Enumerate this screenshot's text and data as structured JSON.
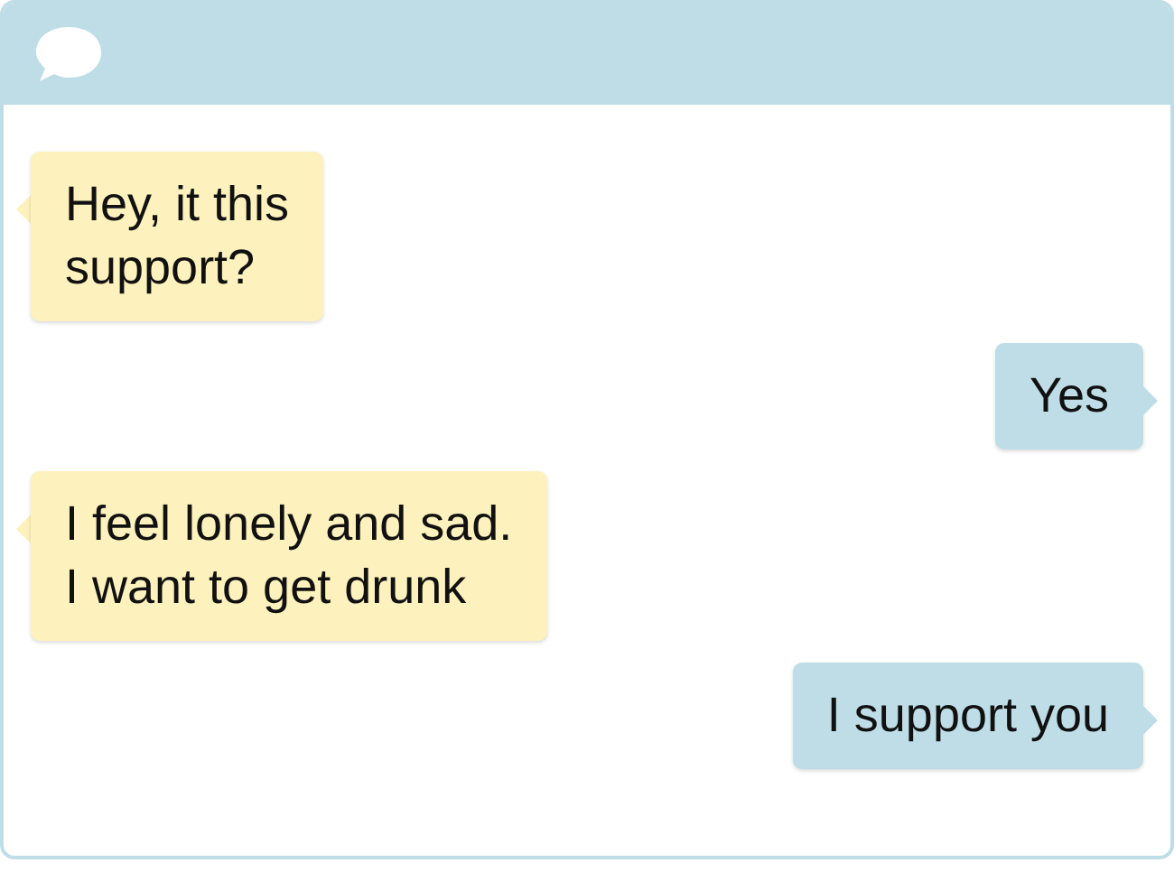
{
  "messages": [
    {
      "kind": "incoming",
      "text": "Hey, it this\nsupport?"
    },
    {
      "kind": "outgoing",
      "text": "Yes"
    },
    {
      "kind": "incoming",
      "text": "I feel lonely and sad.\nI want to get drunk"
    },
    {
      "kind": "outgoing",
      "text": "I support you"
    }
  ]
}
